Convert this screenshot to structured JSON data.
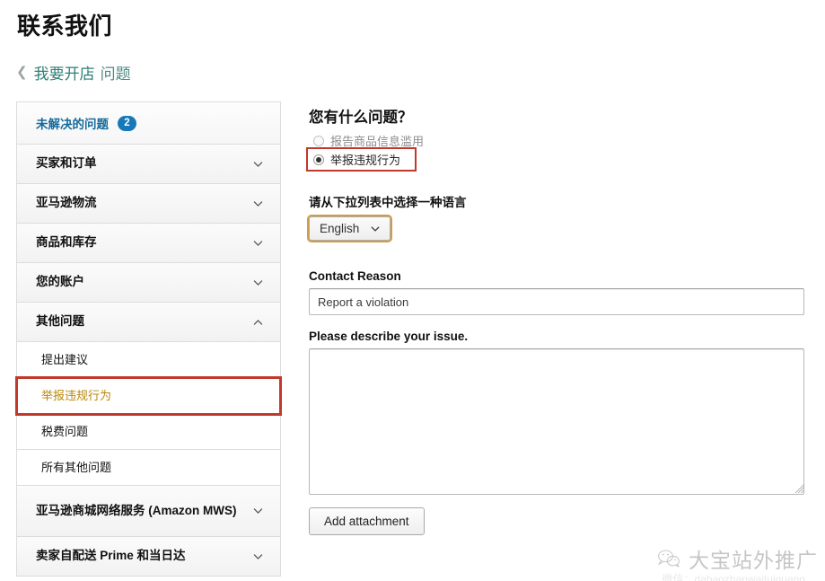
{
  "header": {
    "title": "联系我们",
    "breadcrumb": {
      "back_icon": "chevron-left-icon",
      "link": "我要开店",
      "current": "问题"
    }
  },
  "sidebar": {
    "unresolved": {
      "label": "未解决的问题",
      "count": "2"
    },
    "items": [
      {
        "label": "买家和订单",
        "icon": "chevron-down-icon",
        "type": "group",
        "expanded": false
      },
      {
        "label": "亚马逊物流",
        "icon": "chevron-down-icon",
        "type": "group",
        "expanded": false
      },
      {
        "label": "商品和库存",
        "icon": "chevron-down-icon",
        "type": "group",
        "expanded": false
      },
      {
        "label": "您的账户",
        "icon": "chevron-down-icon",
        "type": "group",
        "expanded": false
      },
      {
        "label": "其他问题",
        "icon": "chevron-up-icon",
        "type": "group",
        "expanded": true
      },
      {
        "label": "提出建议",
        "type": "sub",
        "highlighted": false
      },
      {
        "label": "举报违规行为",
        "type": "sub",
        "highlighted": true
      },
      {
        "label": "税费问题",
        "type": "sub",
        "highlighted": false
      },
      {
        "label": "所有其他问题",
        "type": "sub",
        "highlighted": false
      },
      {
        "label": "亚马逊商城网络服务 (Amazon MWS)",
        "icon": "chevron-down-icon",
        "type": "group",
        "expanded": false
      },
      {
        "label": "卖家自配送 Prime 和当日达",
        "icon": "chevron-down-icon",
        "type": "group",
        "expanded": false
      }
    ]
  },
  "main": {
    "question_title": "您有什么问题？",
    "radio_options": [
      {
        "label": "报告商品信息滥用",
        "checked": false,
        "dimmed": true,
        "highlighted": false
      },
      {
        "label": "举报违规行为",
        "checked": true,
        "dimmed": false,
        "highlighted": true
      }
    ],
    "language_label": "请从下拉列表中选择一种语言",
    "language_value": "English",
    "language_caret_icon": "chevron-down-icon",
    "contact_reason_label": "Contact Reason",
    "contact_reason_value": "Report a violation",
    "contact_reason_placeholder": "",
    "describe_label": "Please describe your issue.",
    "describe_value": "",
    "describe_placeholder": "",
    "add_attachment_label": "Add attachment"
  },
  "watermark": {
    "icon": "wechat-icon",
    "text": "大宝站外推广",
    "subtext": "微信：dabaozhanwaituiguang"
  },
  "colors": {
    "accent_blue": "#1878b9",
    "link_teal": "#2d7f76",
    "annotation_red": "#c0392b",
    "annotation_orange": "#d19d43",
    "highlight_gold": "#b8860b"
  }
}
